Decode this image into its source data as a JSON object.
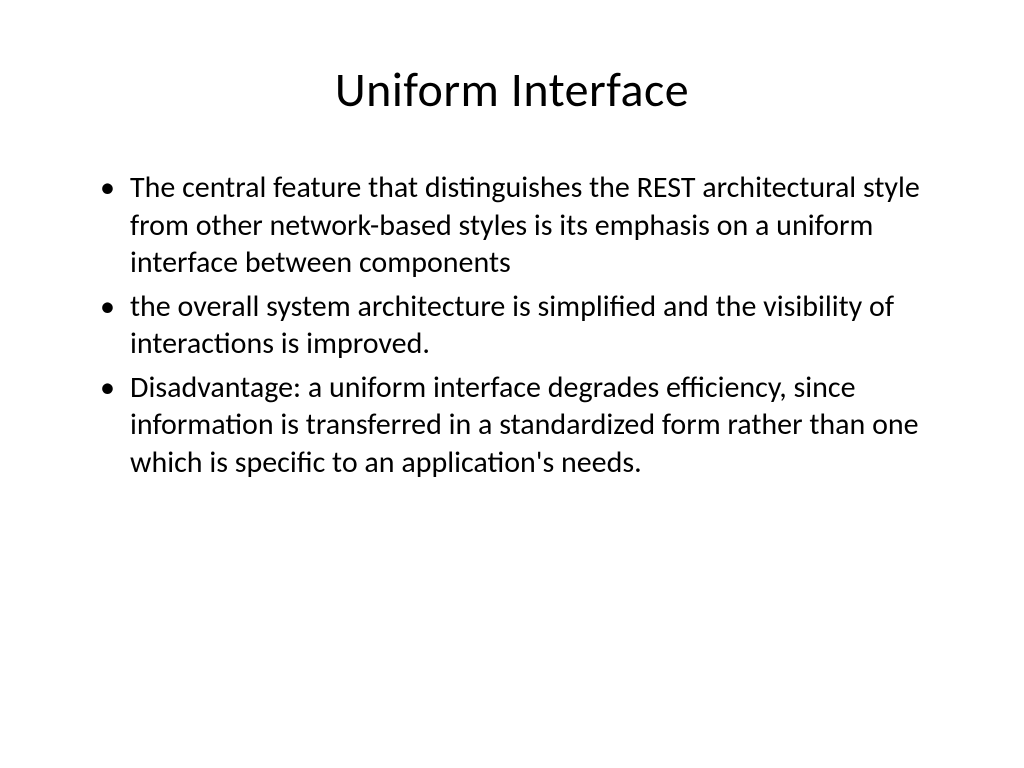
{
  "slide": {
    "title": "Uniform Interface",
    "bullets": [
      "The central feature that distinguishes the REST architectural style from other network-based styles is its emphasis on a uniform interface between components",
      "the overall system architecture is simplified and the visibility of interactions is improved.",
      "Disadvantage: a uniform interface degrades efficiency, since information is transferred in a standardized form rather than one which is specific to an application's needs."
    ]
  }
}
